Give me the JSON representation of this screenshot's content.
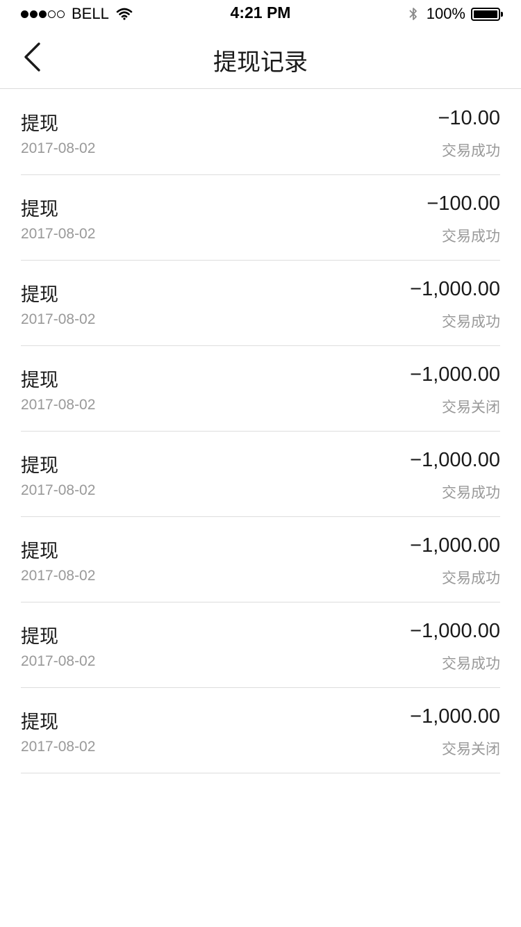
{
  "status_bar": {
    "signal_filled": 3,
    "signal_total": 5,
    "carrier": "BELL",
    "time": "4:21 PM",
    "battery": "100%",
    "battery_level": 1.0
  },
  "nav": {
    "title": "提现记录",
    "back_icon": "chevron-left-icon"
  },
  "colors": {
    "primary_text": "#1a1a1a",
    "secondary_text": "#999999",
    "divider": "#dddddd"
  },
  "records": [
    {
      "type": "提现",
      "date": "2017-08-02",
      "amount": "−10.00",
      "status": "交易成功"
    },
    {
      "type": "提现",
      "date": "2017-08-02",
      "amount": "−100.00",
      "status": "交易成功"
    },
    {
      "type": "提现",
      "date": "2017-08-02",
      "amount": "−1,000.00",
      "status": "交易成功"
    },
    {
      "type": "提现",
      "date": "2017-08-02",
      "amount": "−1,000.00",
      "status": "交易关闭"
    },
    {
      "type": "提现",
      "date": "2017-08-02",
      "amount": "−1,000.00",
      "status": "交易成功"
    },
    {
      "type": "提现",
      "date": "2017-08-02",
      "amount": "−1,000.00",
      "status": "交易成功"
    },
    {
      "type": "提现",
      "date": "2017-08-02",
      "amount": "−1,000.00",
      "status": "交易成功"
    },
    {
      "type": "提现",
      "date": "2017-08-02",
      "amount": "−1,000.00",
      "status": "交易关闭"
    }
  ]
}
